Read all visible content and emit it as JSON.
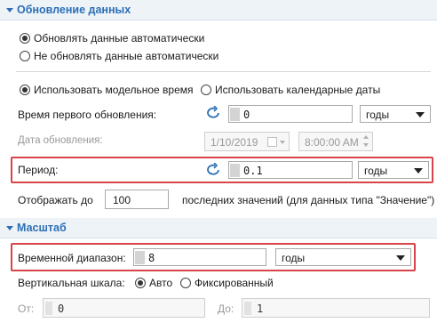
{
  "update_section": {
    "title": "Обновление данных",
    "auto_update_label": "Обновлять данные автоматически",
    "no_auto_update_label": "Не обновлять данные автоматически",
    "model_time_label": "Использовать модельное время",
    "calendar_dates_label": "Использовать календарные даты",
    "first_update_label": "Время первого обновления:",
    "first_update_value": "0",
    "first_update_unit": "годы",
    "update_date_label": "Дата обновления:",
    "update_date_value": "1/10/2019",
    "update_time_value": "8:00:00 AM",
    "period_label": "Период:",
    "period_value": "0.1",
    "period_unit": "годы",
    "show_up_to_label": "Отображать до",
    "show_up_to_value": "100",
    "last_values_label": "последних значений (для данных типа \"Значение\")"
  },
  "scale_section": {
    "title": "Масштаб",
    "time_range_label": "Временной диапазон:",
    "time_range_value": "8",
    "time_range_unit": "годы",
    "vertical_scale_label": "Вертикальная шкала:",
    "auto_label": "Авто",
    "fixed_label": "Фиксированный",
    "from_label": "От:",
    "from_value": "0",
    "to_label": "До:",
    "to_value": "1"
  },
  "state": {
    "update_mode": "auto",
    "time_mode": "model",
    "vertical_scale": "auto"
  },
  "colors": {
    "accent": "#2c6fb5",
    "highlight_border": "#d9434a"
  }
}
